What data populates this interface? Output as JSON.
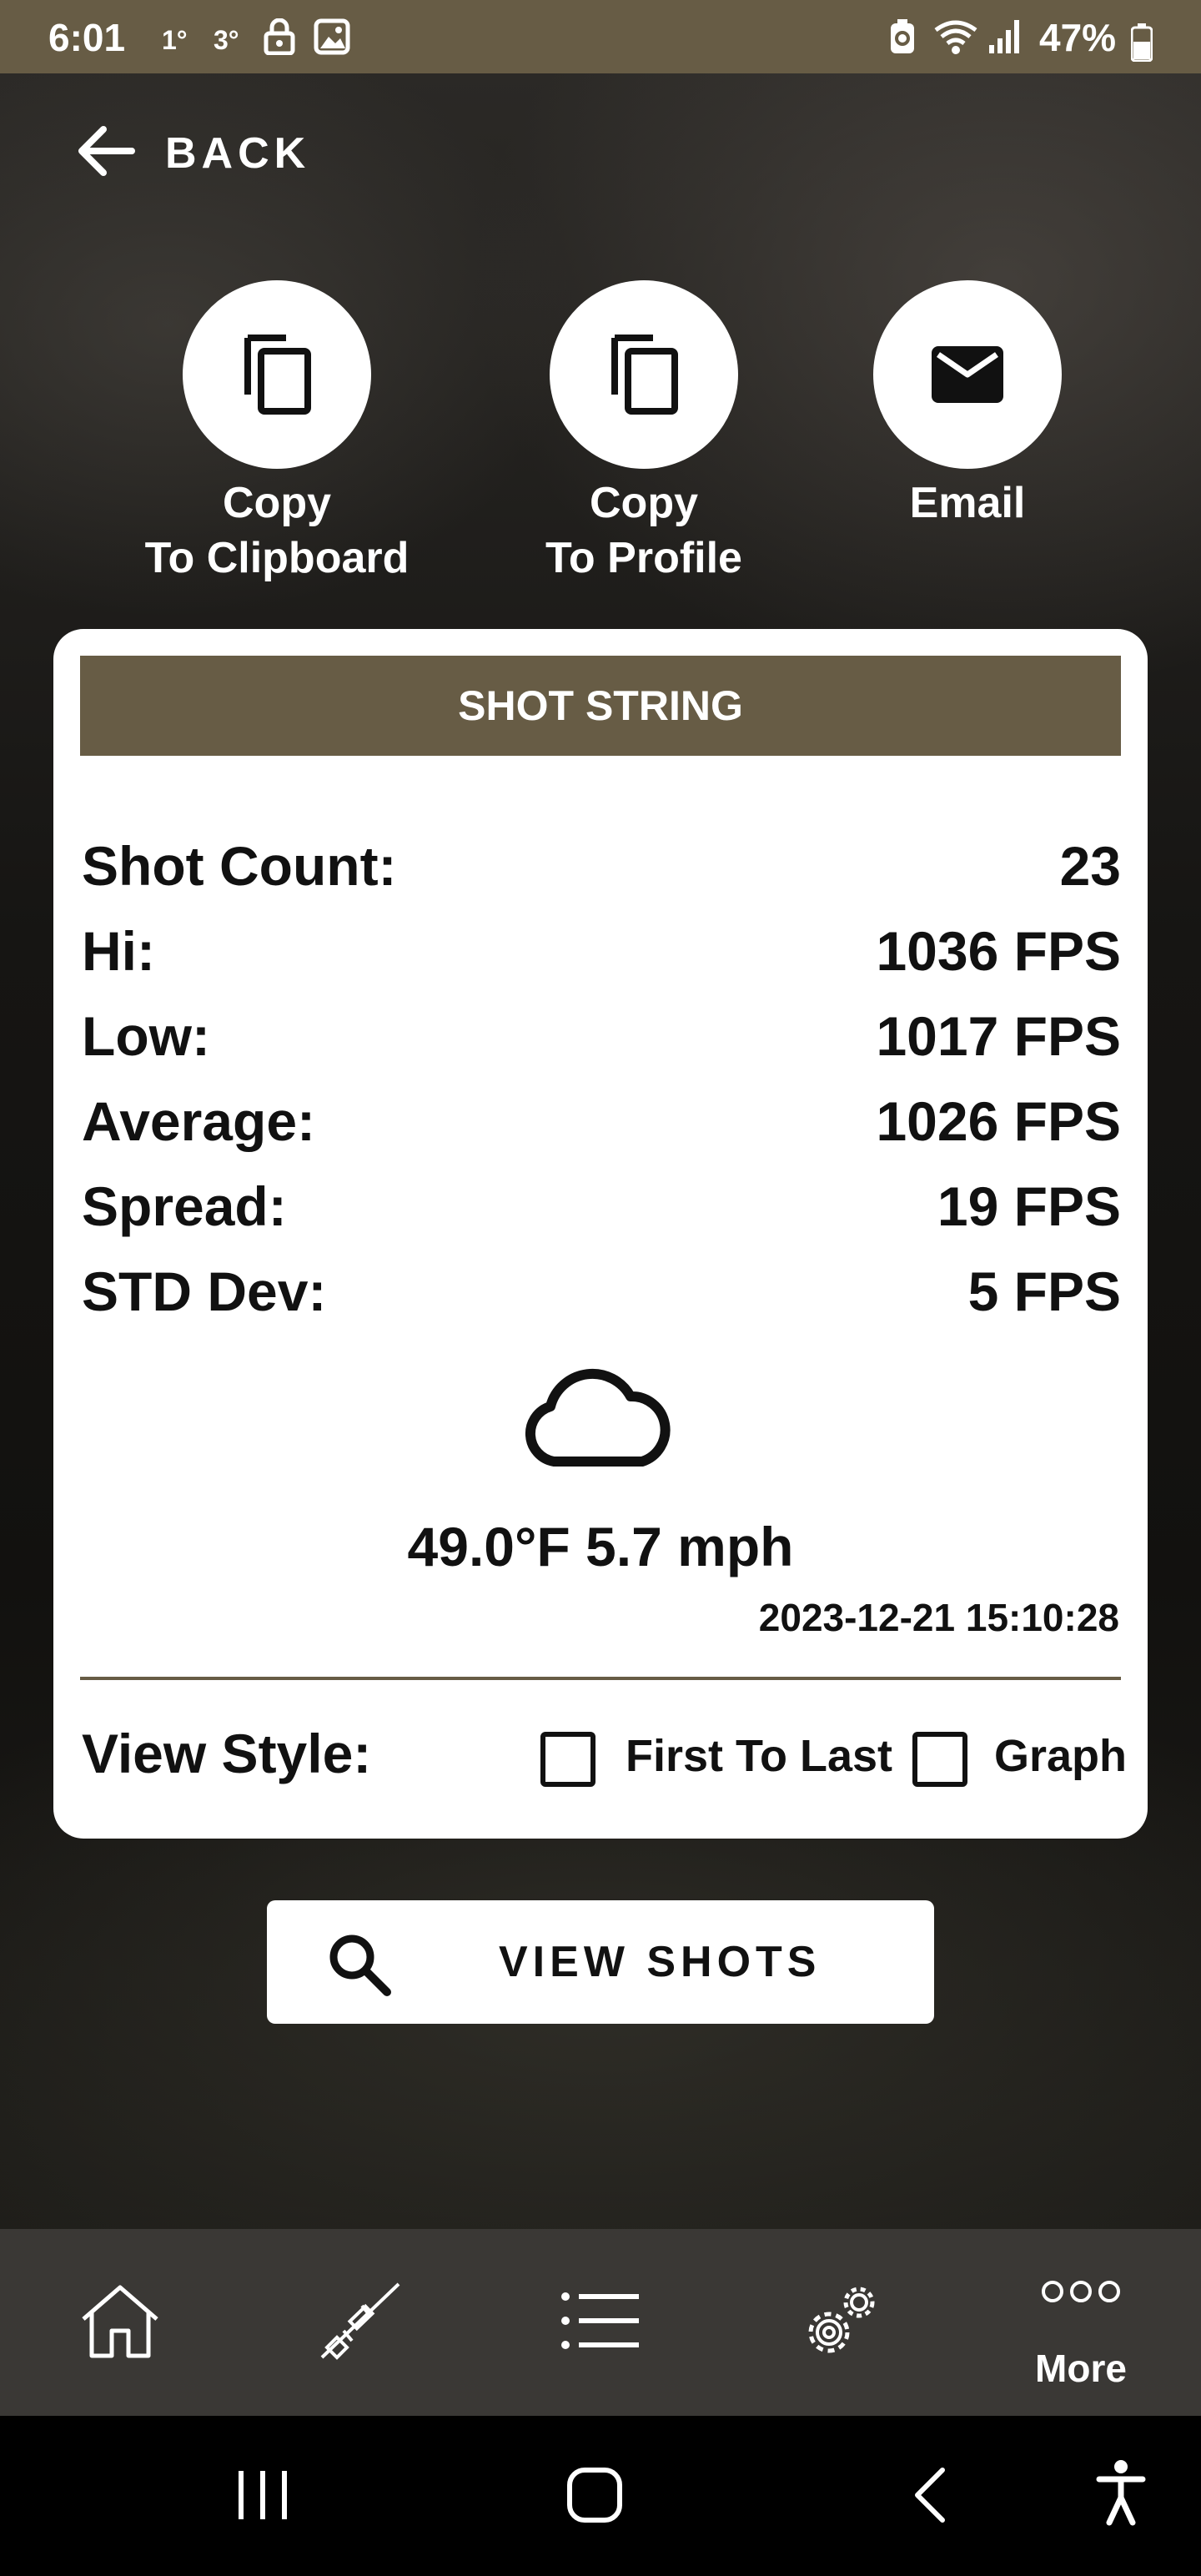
{
  "status_bar": {
    "time": "6:01",
    "temp1": "1°",
    "temp2": "3°",
    "battery_percent": "47%"
  },
  "nav": {
    "back_label": "BACK"
  },
  "actions": [
    {
      "line1": "Copy",
      "line2": "To Clipboard",
      "icon": "copy-icon"
    },
    {
      "line1": "Copy",
      "line2": "To Profile",
      "icon": "copy-icon"
    },
    {
      "line1": "Email",
      "line2": "",
      "icon": "email-icon"
    }
  ],
  "card": {
    "header": "SHOT STRING",
    "stats": [
      {
        "label": "Shot Count:",
        "value": "23"
      },
      {
        "label": "Hi:",
        "value": "1036 FPS"
      },
      {
        "label": "Low:",
        "value": "1017 FPS"
      },
      {
        "label": "Average:",
        "value": "1026 FPS"
      },
      {
        "label": "Spread:",
        "value": "19 FPS"
      },
      {
        "label": "STD Dev:",
        "value": "5 FPS"
      }
    ],
    "weather": {
      "icon": "cloud-icon",
      "text": "49.0°F 5.7 mph",
      "timestamp": "2023-12-21 15:10:28"
    },
    "view_style": {
      "label": "View Style:",
      "options": [
        {
          "label": "First To Last",
          "checked": false
        },
        {
          "label": "Graph",
          "checked": false
        }
      ]
    }
  },
  "view_shots_button": "VIEW SHOTS",
  "bottom_nav": {
    "items": [
      "home-icon",
      "rifle-icon",
      "list-icon",
      "settings-icon",
      "more-icon"
    ],
    "more_label": "More"
  },
  "colors": {
    "brand": "#675c45",
    "card_bg": "#ffffff",
    "nav_bg": "#3a3835"
  }
}
